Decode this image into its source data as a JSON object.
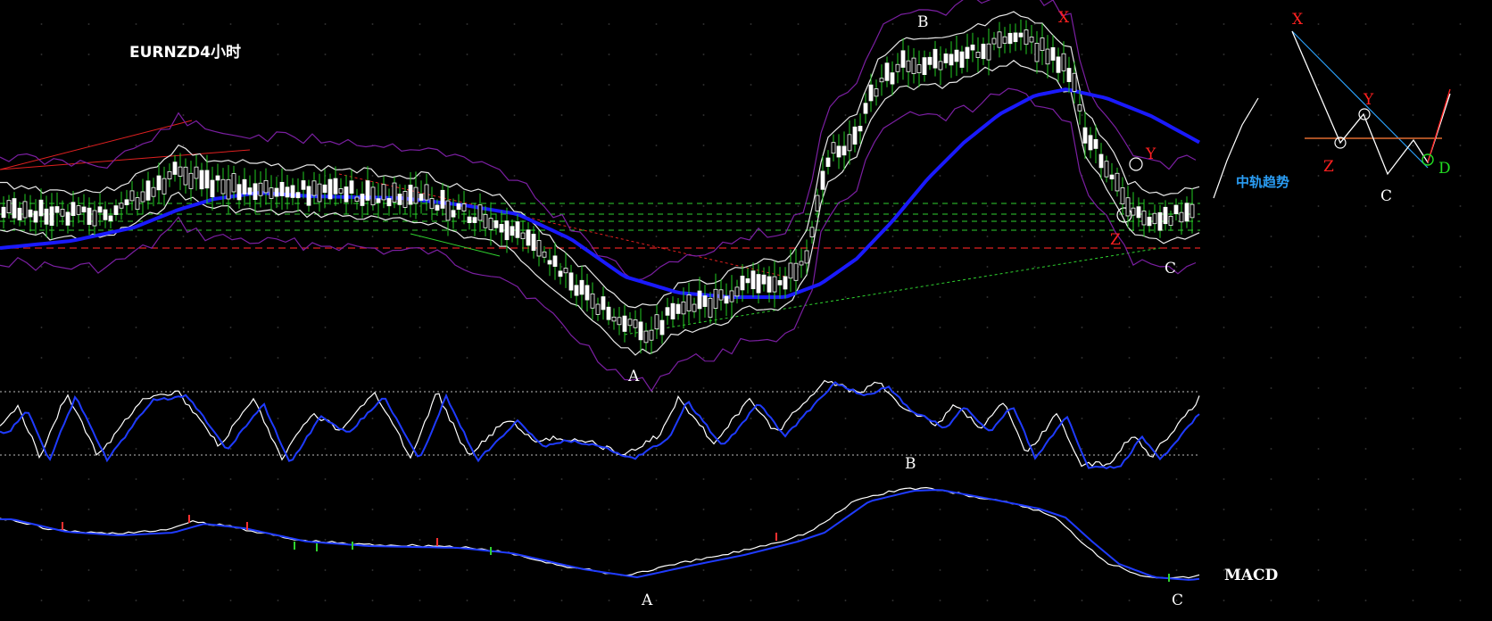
{
  "chart_data": {
    "type": "candlestick",
    "symbol_label": "EURNZD4小时",
    "midline_label": "中轨趋势",
    "indicator_label": "MACD",
    "wave_labels": [
      "A",
      "B",
      "C",
      "X",
      "Y",
      "Z",
      "A",
      "B",
      "C",
      "X",
      "Y",
      "Z",
      "C",
      "D",
      "A",
      "C"
    ],
    "colors": {
      "background": "#000000",
      "candle": "#ffffff",
      "wick": "#22cc22",
      "midline": "#1a1aff",
      "band": "#e8e8e8",
      "outer_band": "#7b1fa2",
      "signal": "#1f3bff",
      "label_red": "#ff2020",
      "label_blue": "#2a9df4",
      "label_green": "#22dd22"
    }
  }
}
